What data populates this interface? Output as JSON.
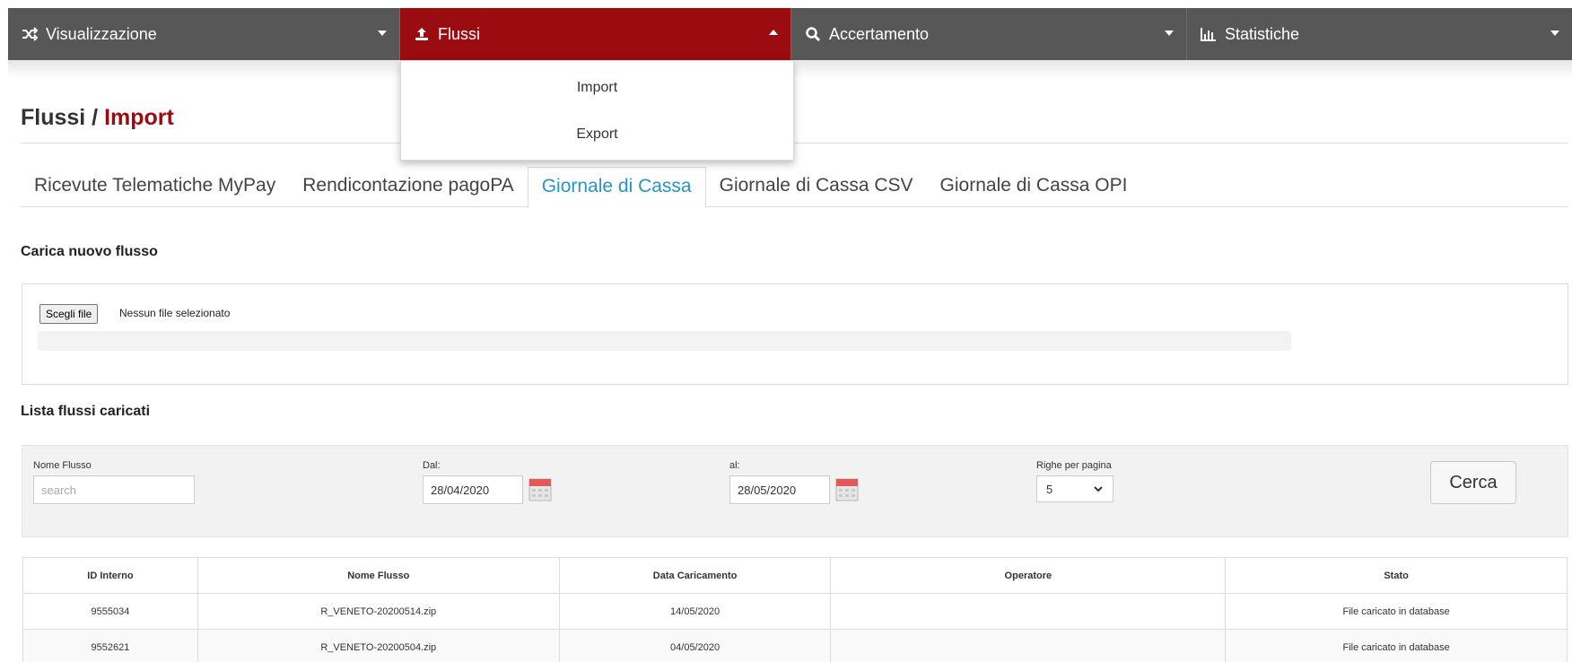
{
  "nav": {
    "items": [
      {
        "label": "Visualizzazione",
        "icon": "shuffle-icon"
      },
      {
        "label": "Flussi",
        "icon": "upload-icon"
      },
      {
        "label": "Accertamento",
        "icon": "search-icon"
      },
      {
        "label": "Statistiche",
        "icon": "bar-chart-icon"
      }
    ],
    "active_color": "#9b0c11",
    "bar_color": "#575757"
  },
  "dropdown": {
    "items": [
      "Import",
      "Export"
    ]
  },
  "page": {
    "title_prefix": "Flussi / ",
    "title_accent": "Import"
  },
  "tabs": [
    {
      "label": "Ricevute Telematiche MyPay"
    },
    {
      "label": "Rendicontazione pagoPA"
    },
    {
      "label": "Giornale di Cassa"
    },
    {
      "label": "Giornale di Cassa CSV"
    },
    {
      "label": "Giornale di Cassa OPI"
    }
  ],
  "upload": {
    "heading": "Carica nuovo flusso",
    "choose_file_label": "Scegli file",
    "no_file_label": "Nessun file selezionato",
    "progress": 0
  },
  "list": {
    "heading": "Lista flussi caricati"
  },
  "filters": {
    "nome_flusso_label": "Nome Flusso",
    "nome_flusso_placeholder": "search",
    "dal_label": "Dal:",
    "dal_value": "28/04/2020",
    "al_label": "al:",
    "al_value": "28/05/2020",
    "righe_label": "Righe per pagina",
    "righe_value": "5",
    "search_button": "Cerca"
  },
  "table": {
    "headers": [
      "ID Interno",
      "Nome Flusso",
      "Data Caricamento",
      "Operatore",
      "Stato"
    ],
    "rows": [
      [
        "9555034",
        "R_VENETO-20200514.zip",
        "14/05/2020",
        "",
        "File caricato in database"
      ],
      [
        "9552621",
        "R_VENETO-20200504.zip",
        "04/05/2020",
        "",
        "File caricato in database"
      ]
    ]
  }
}
